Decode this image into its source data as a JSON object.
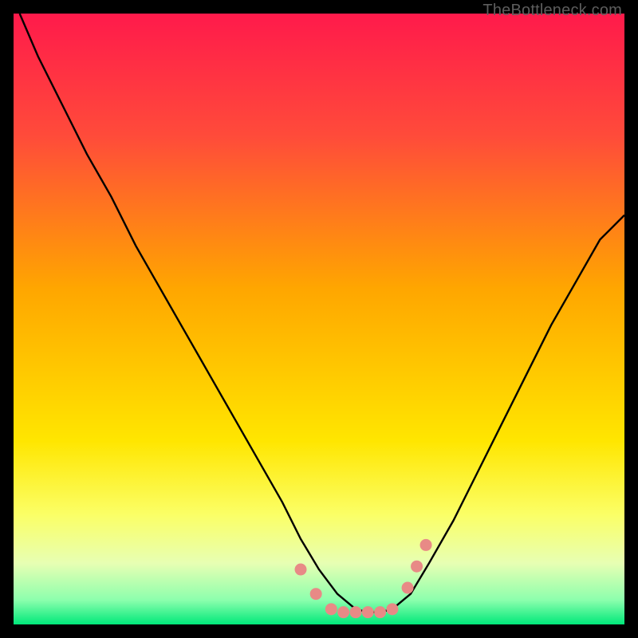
{
  "watermark": "TheBottleneck.com",
  "chart_data": {
    "type": "line",
    "title": "",
    "xlabel": "",
    "ylabel": "",
    "xlim": [
      0,
      100
    ],
    "ylim": [
      0,
      100
    ],
    "background_gradient": {
      "stops": [
        {
          "offset": 0.0,
          "color": "#ff1a4b"
        },
        {
          "offset": 0.2,
          "color": "#ff4b3a"
        },
        {
          "offset": 0.45,
          "color": "#ffa600"
        },
        {
          "offset": 0.7,
          "color": "#ffe600"
        },
        {
          "offset": 0.82,
          "color": "#fbff66"
        },
        {
          "offset": 0.9,
          "color": "#e7ffb3"
        },
        {
          "offset": 0.96,
          "color": "#8cffad"
        },
        {
          "offset": 1.0,
          "color": "#00e87a"
        }
      ]
    },
    "series": [
      {
        "name": "curve",
        "type": "line",
        "color": "#000000",
        "x": [
          1,
          4,
          8,
          12,
          16,
          20,
          24,
          28,
          32,
          36,
          40,
          44,
          47,
          50,
          53,
          56,
          58,
          60,
          62,
          65,
          68,
          72,
          76,
          80,
          84,
          88,
          92,
          96,
          100
        ],
        "y": [
          100,
          93,
          85,
          77,
          70,
          62,
          55,
          48,
          41,
          34,
          27,
          20,
          14,
          9,
          5,
          2.5,
          2,
          2,
          2.5,
          5,
          10,
          17,
          25,
          33,
          41,
          49,
          56,
          63,
          67
        ]
      },
      {
        "name": "markers",
        "type": "scatter",
        "color": "#e88a86",
        "x": [
          47,
          49.5,
          52,
          54,
          56,
          58,
          60,
          62,
          64.5,
          66,
          67.5
        ],
        "y": [
          9,
          5,
          2.5,
          2,
          2,
          2,
          2,
          2.5,
          6,
          9.5,
          13
        ]
      }
    ]
  }
}
